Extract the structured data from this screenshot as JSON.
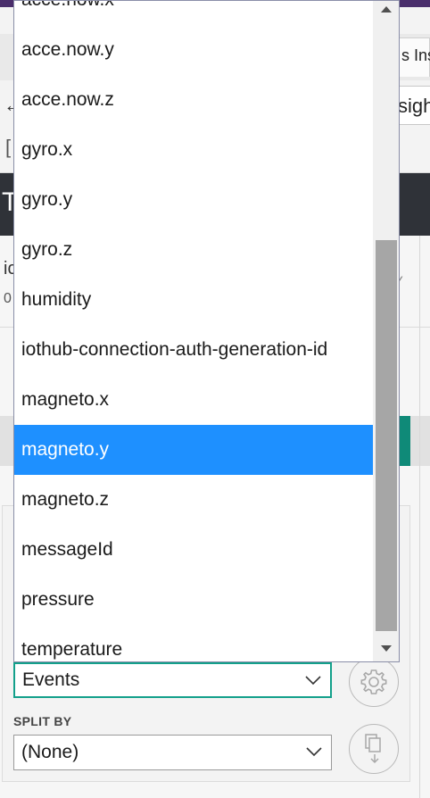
{
  "background": {
    "tab_text": "s Ins",
    "address_text": "sigh",
    "dark_bar_letter": "T",
    "panel_label_short": "ic",
    "panel_value_short": "0"
  },
  "dropdown": {
    "items": [
      "acce.now.x",
      "acce.now.y",
      "acce.now.z",
      "gyro.x",
      "gyro.y",
      "gyro.z",
      "humidity",
      "iothub-connection-auth-generation-id",
      "magneto.x",
      "magneto.y",
      "magneto.z",
      "messageId",
      "pressure",
      "temperature"
    ],
    "selected": "magneto.y",
    "selected_color": "#1e90ff"
  },
  "measure_select": {
    "value": "Events",
    "accent_color": "#13a08b"
  },
  "split_by": {
    "label": "SPLIT BY",
    "value": "(None)"
  },
  "icons": {
    "settings": "gear-icon",
    "copy": "copy-down-icon",
    "scroll_up": "scroll-up-arrow-icon",
    "scroll_down": "scroll-down-arrow-icon"
  }
}
